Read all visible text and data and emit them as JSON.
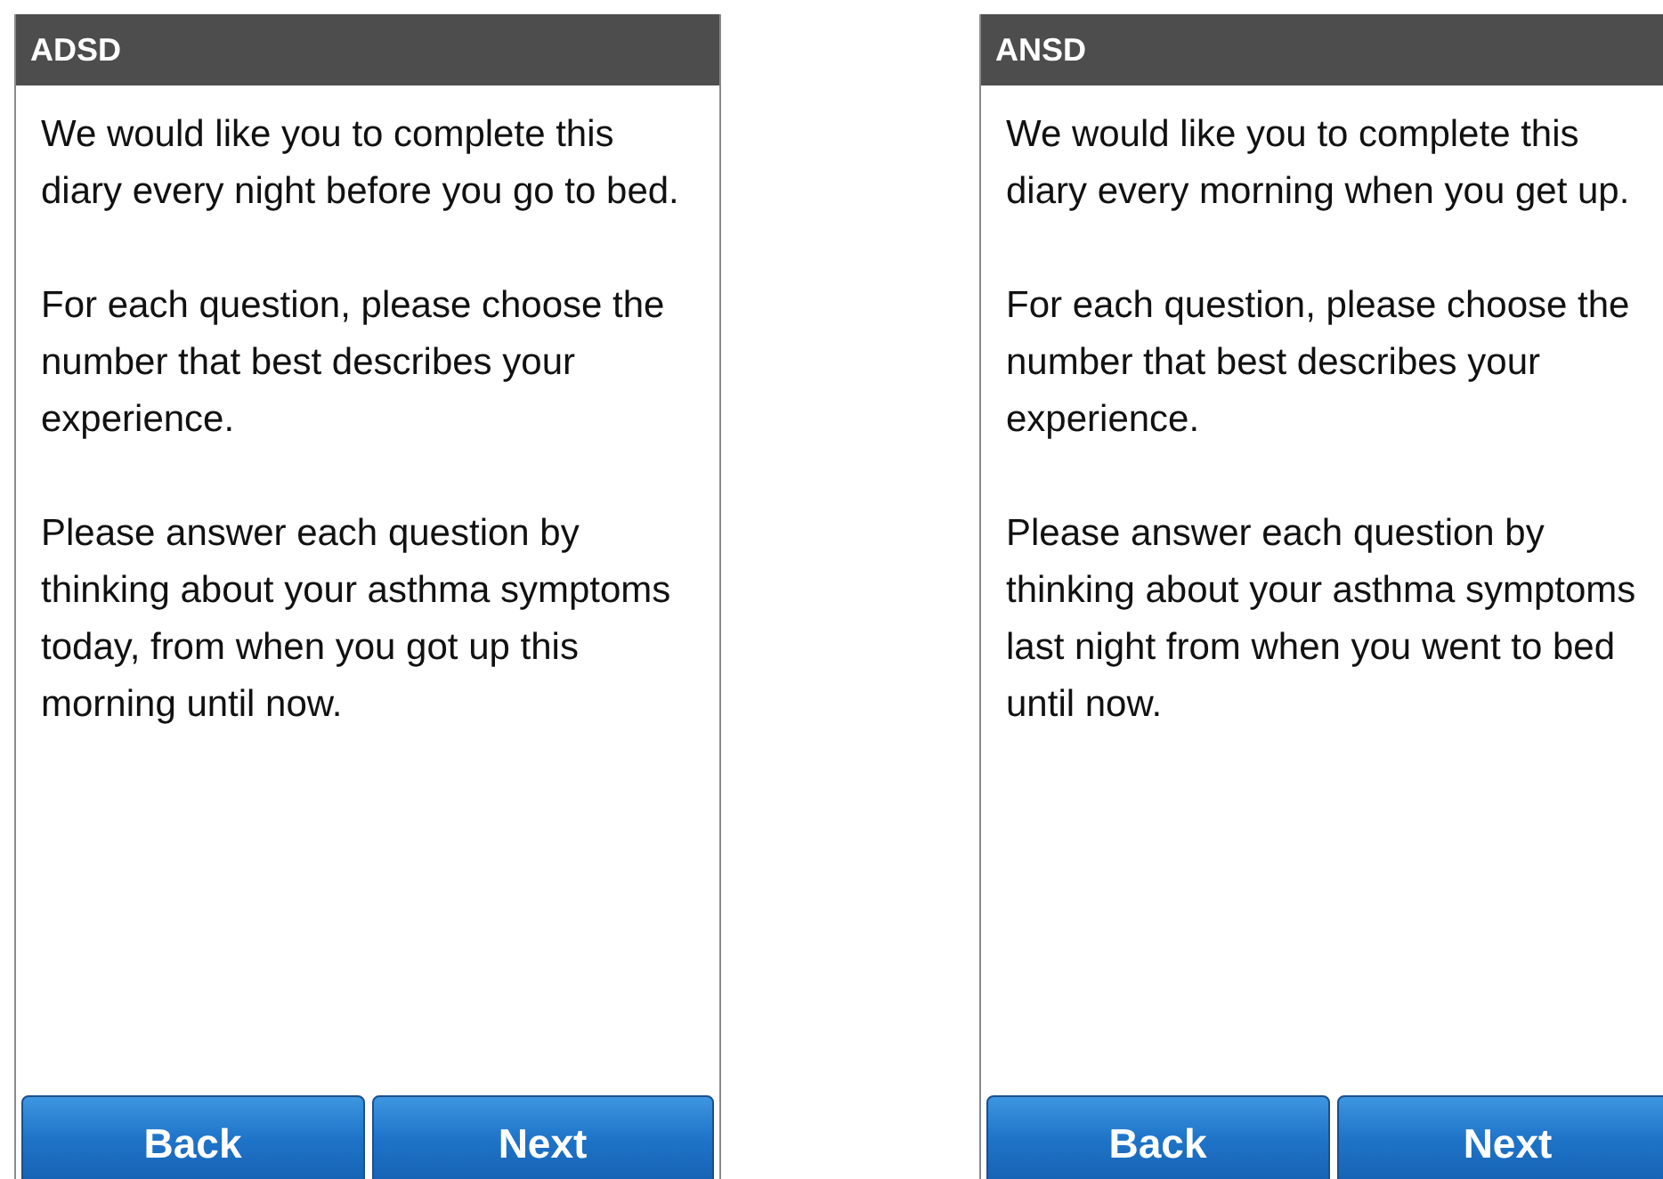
{
  "screens": [
    {
      "title": "ADSD",
      "paragraphs": [
        "We would like you to complete this diary every night before you go to bed.",
        "For each question, please choose the number that best describes your experience.",
        "Please answer each question by thinking about your asthma symptoms today, from when you got up this morning until now."
      ],
      "buttons": [
        {
          "label": "Back"
        },
        {
          "label": "Next"
        }
      ]
    },
    {
      "title": "ANSD",
      "paragraphs": [
        "We would like you to complete this diary every morning when you get up.",
        "For each question, please choose the number that best describes your experience.",
        "Please answer each question by thinking about your asthma symptoms last night from when you went to bed until now."
      ],
      "buttons": [
        {
          "label": "Back"
        },
        {
          "label": "Next"
        }
      ]
    }
  ]
}
